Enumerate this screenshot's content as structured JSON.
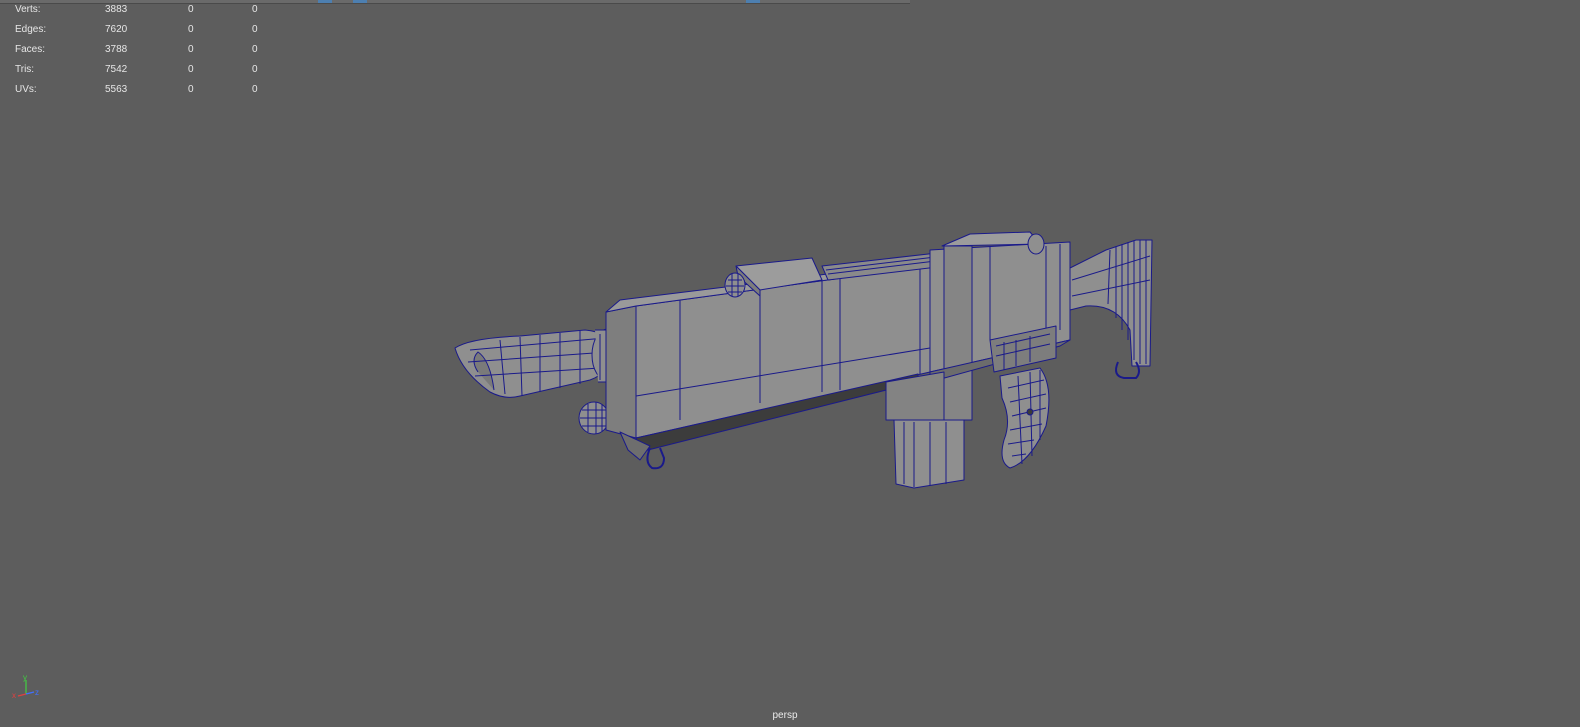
{
  "viewport": {
    "camera": "persp"
  },
  "hud": {
    "rows": [
      {
        "label": "Verts:",
        "value": "3883",
        "selected": "0",
        "selected_tris": "0"
      },
      {
        "label": "Edges:",
        "value": "7620",
        "selected": "0",
        "selected_tris": "0"
      },
      {
        "label": "Faces:",
        "value": "3788",
        "selected": "0",
        "selected_tris": "0"
      },
      {
        "label": "Tris:",
        "value": "7542",
        "selected": "0",
        "selected_tris": "0"
      },
      {
        "label": "UVs:",
        "value": "5563",
        "selected": "0",
        "selected_tris": "0"
      }
    ]
  },
  "axis_gizmo": {
    "x_label": "x",
    "y_label": "y",
    "z_label": "z",
    "x_color": "#e04040",
    "y_color": "#40d040",
    "z_color": "#4070ff"
  },
  "colors": {
    "background": "#5d5d5d",
    "mesh_fill": "#8f8f8f",
    "mesh_wire": "#1a1a8a",
    "hud_text": "#e6e6e6"
  }
}
